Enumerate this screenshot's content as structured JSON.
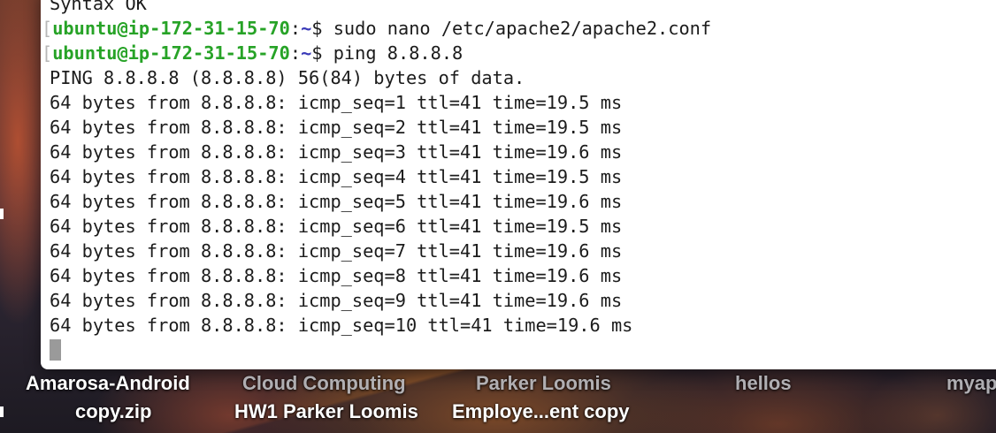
{
  "terminal": {
    "top_partial_line": "Syntax OK",
    "commands": [
      {
        "bracket": "[",
        "user_host": "ubuntu@ip-172-31-15-70",
        "separator": ":",
        "path": "~",
        "prompt": "$",
        "command": " sudo nano /etc/apache2/apache2.conf"
      },
      {
        "bracket": "[",
        "user_host": "ubuntu@ip-172-31-15-70",
        "separator": ":",
        "path": "~",
        "prompt": "$",
        "command": " ping 8.8.8.8"
      }
    ],
    "output_lines": [
      "PING 8.8.8.8 (8.8.8.8) 56(84) bytes of data.",
      "64 bytes from 8.8.8.8: icmp_seq=1 ttl=41 time=19.5 ms",
      "64 bytes from 8.8.8.8: icmp_seq=2 ttl=41 time=19.5 ms",
      "64 bytes from 8.8.8.8: icmp_seq=3 ttl=41 time=19.6 ms",
      "64 bytes from 8.8.8.8: icmp_seq=4 ttl=41 time=19.5 ms",
      "64 bytes from 8.8.8.8: icmp_seq=5 ttl=41 time=19.6 ms",
      "64 bytes from 8.8.8.8: icmp_seq=6 ttl=41 time=19.5 ms",
      "64 bytes from 8.8.8.8: icmp_seq=7 ttl=41 time=19.6 ms",
      "64 bytes from 8.8.8.8: icmp_seq=8 ttl=41 time=19.6 ms",
      "64 bytes from 8.8.8.8: icmp_seq=9 ttl=41 time=19.6 ms",
      "64 bytes from 8.8.8.8: icmp_seq=10 ttl=41 time=19.6 ms"
    ],
    "colors": {
      "user_host": "#27a327",
      "path": "#3a3ab8",
      "text": "#1c1c1c",
      "cursor": "#9a9a9a"
    }
  },
  "desktop": {
    "icons_row1": [
      "Amarosa-Android",
      "Cloud Computing",
      "Parker Loomis",
      "hellos",
      "myap"
    ],
    "icons_row2": [
      "copy.zip",
      "HW1 Parker Loomis",
      "Employe...ent copy"
    ]
  }
}
